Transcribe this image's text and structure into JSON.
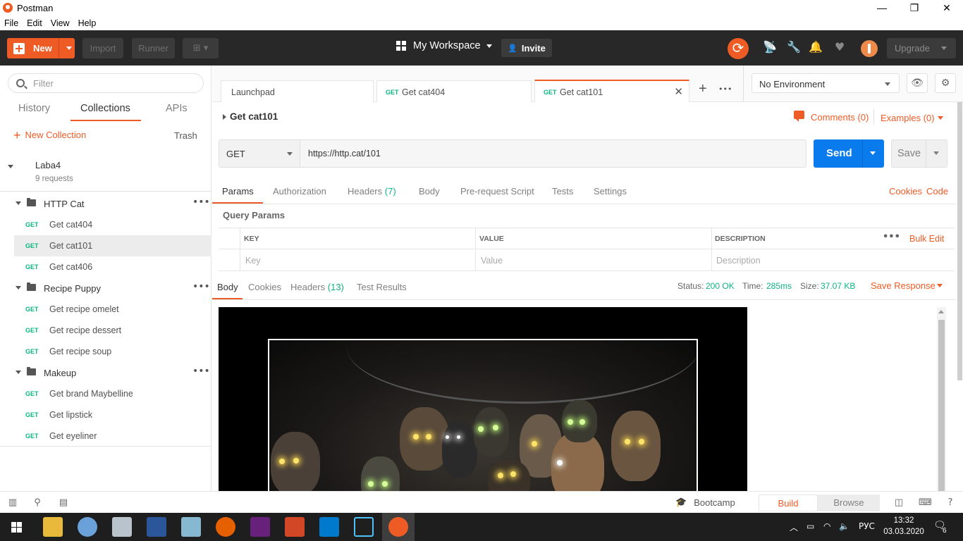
{
  "window": {
    "title": "Postman",
    "minimize": "—",
    "maximize": "❐",
    "close": "✕"
  },
  "menu": [
    "File",
    "Edit",
    "View",
    "Help"
  ],
  "header": {
    "new_label": "New",
    "import_label": "Import",
    "runner_label": "Runner",
    "workspace_label": "My Workspace",
    "invite_label": "Invite",
    "upgrade_label": "Upgrade",
    "accent": "#ef5b25"
  },
  "sidebar": {
    "filter_placeholder": "Filter",
    "tabs": [
      "History",
      "Collections",
      "APIs"
    ],
    "new_collection": "New Collection",
    "trash": "Trash",
    "collection": {
      "name": "Laba4",
      "subtitle": "9 requests"
    },
    "folders": [
      {
        "name": "HTTP Cat",
        "requests": [
          {
            "method": "GET",
            "name": "Get cat404"
          },
          {
            "method": "GET",
            "name": "Get cat101",
            "selected": true
          },
          {
            "method": "GET",
            "name": "Get cat406"
          }
        ]
      },
      {
        "name": "Recipe Puppy",
        "requests": [
          {
            "method": "GET",
            "name": "Get recipe omelet"
          },
          {
            "method": "GET",
            "name": "Get recipe dessert"
          },
          {
            "method": "GET",
            "name": "Get recipe soup"
          }
        ]
      },
      {
        "name": "Makeup",
        "requests": [
          {
            "method": "GET",
            "name": "Get brand Maybelline"
          },
          {
            "method": "GET",
            "name": "Get lipstick"
          },
          {
            "method": "GET",
            "name": "Get eyeliner"
          }
        ]
      }
    ]
  },
  "tabs": {
    "items": [
      {
        "method": "",
        "title": "Launchpad"
      },
      {
        "method": "GET",
        "title": "Get cat404"
      },
      {
        "method": "GET",
        "title": "Get cat101",
        "active": true
      }
    ],
    "close": "✕",
    "add": "+",
    "more": "•••"
  },
  "environment": {
    "selected": "No Environment"
  },
  "request": {
    "title": "Get cat101",
    "comments": "Comments (0)",
    "examples": "Examples (0)",
    "method": "GET",
    "url": "https://http.cat/101",
    "send": "Send",
    "save": "Save",
    "tabs": {
      "params": "Params",
      "authorization": "Authorization",
      "headers": "Headers",
      "headers_count": "(7)",
      "body": "Body",
      "prerequest": "Pre-request Script",
      "tests": "Tests",
      "settings": "Settings"
    },
    "cookies": "Cookies",
    "code": "Code",
    "query_params_title": "Query Params",
    "table": {
      "headers": [
        "KEY",
        "VALUE",
        "DESCRIPTION"
      ],
      "placeholders": [
        "Key",
        "Value",
        "Description"
      ],
      "bulk_edit": "Bulk Edit"
    }
  },
  "response": {
    "tabs": {
      "body": "Body",
      "cookies": "Cookies",
      "headers": "Headers",
      "headers_count": "(13)",
      "test_results": "Test Results"
    },
    "status_label": "Status:",
    "status_value": "200 OK",
    "time_label": "Time:",
    "time_value": "285ms",
    "size_label": "Size:",
    "size_value": "37.07 KB",
    "save_response": "Save Response"
  },
  "statusbar": {
    "bootcamp": "Bootcamp",
    "build": "Build",
    "browse": "Browse"
  },
  "taskbar": {
    "lang": "РУС",
    "time": "13:32",
    "date": "03.03.2020",
    "notifications": "6"
  }
}
